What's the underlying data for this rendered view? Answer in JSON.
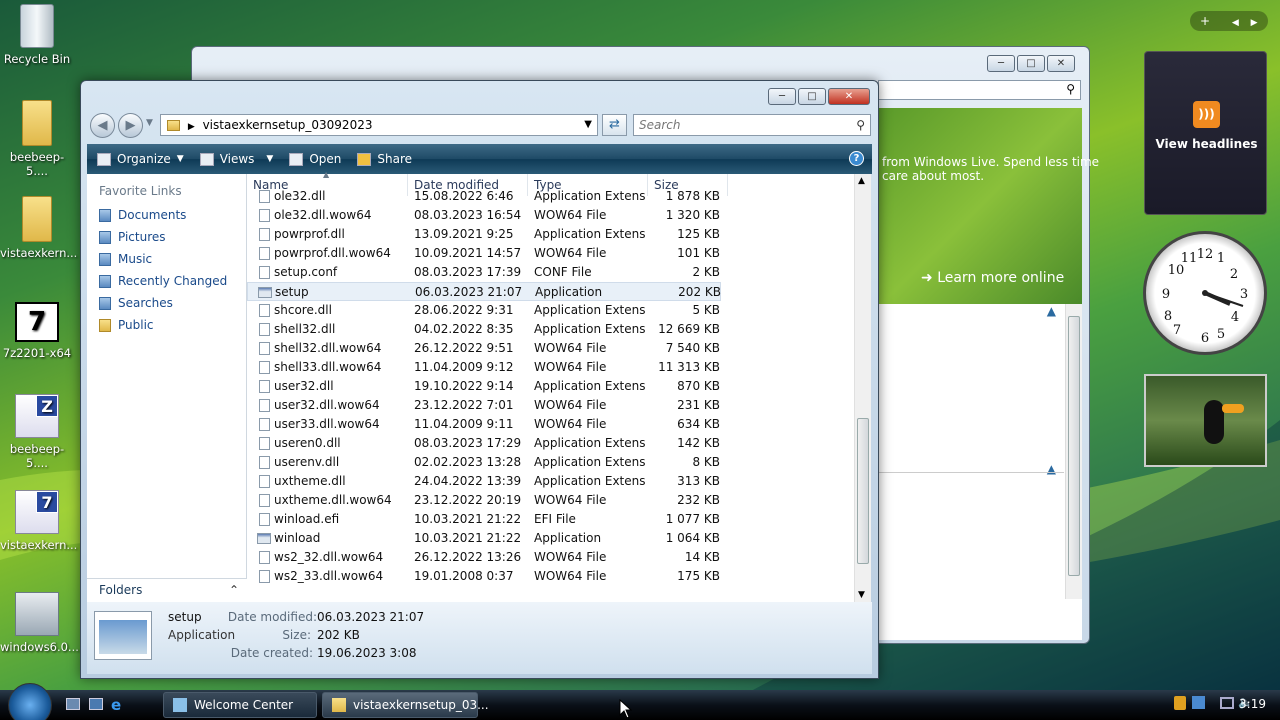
{
  "desktop_icons": [
    {
      "label": "Recycle Bin"
    },
    {
      "label": "beebeep-5...."
    },
    {
      "label": "vistaexkern..."
    },
    {
      "label": "7z2201-x64"
    },
    {
      "label": "beebeep-5...."
    },
    {
      "label": "vistaexkern..."
    },
    {
      "label": "windows6.0...."
    }
  ],
  "icon_glyphs": {
    "zip": "Z",
    "sevenzip": "7"
  },
  "welcome_center": {
    "text": "from Windows Live. Spend less time\ncare about most.",
    "link": "Learn more online"
  },
  "explorer": {
    "address": "vistaexkernsetup_03092023",
    "search_placeholder": "Search",
    "toolbar": {
      "organize": "Organize",
      "views": "Views",
      "open": "Open",
      "share": "Share"
    },
    "nav": {
      "heading": "Favorite Links",
      "links": [
        "Documents",
        "Pictures",
        "Music",
        "Recently Changed",
        "Searches",
        "Public"
      ],
      "folders": "Folders"
    },
    "columns": {
      "name": "Name",
      "date": "Date modified",
      "type": "Type",
      "size": "Size"
    },
    "files": [
      {
        "name": "ole32.dll",
        "date": "15.08.2022 6:46",
        "type": "Application Extens...",
        "size": "1 878 KB"
      },
      {
        "name": "ole32.dll.wow64",
        "date": "08.03.2023 16:54",
        "type": "WOW64 File",
        "size": "1 320 KB"
      },
      {
        "name": "powrprof.dll",
        "date": "13.09.2021 9:25",
        "type": "Application Extens...",
        "size": "125 KB"
      },
      {
        "name": "powrprof.dll.wow64",
        "date": "10.09.2021 14:57",
        "type": "WOW64 File",
        "size": "101 KB"
      },
      {
        "name": "setup.conf",
        "date": "08.03.2023 17:39",
        "type": "CONF File",
        "size": "2 KB"
      },
      {
        "name": "setup",
        "date": "06.03.2023 21:07",
        "type": "Application",
        "size": "202 KB"
      },
      {
        "name": "shcore.dll",
        "date": "28.06.2022 9:31",
        "type": "Application Extens...",
        "size": "5 KB"
      },
      {
        "name": "shell32.dll",
        "date": "04.02.2022 8:35",
        "type": "Application Extens...",
        "size": "12 669 KB"
      },
      {
        "name": "shell32.dll.wow64",
        "date": "26.12.2022 9:51",
        "type": "WOW64 File",
        "size": "7 540 KB"
      },
      {
        "name": "shell33.dll.wow64",
        "date": "11.04.2009 9:12",
        "type": "WOW64 File",
        "size": "11 313 KB"
      },
      {
        "name": "user32.dll",
        "date": "19.10.2022 9:14",
        "type": "Application Extens...",
        "size": "870 KB"
      },
      {
        "name": "user32.dll.wow64",
        "date": "23.12.2022 7:01",
        "type": "WOW64 File",
        "size": "231 KB"
      },
      {
        "name": "user33.dll.wow64",
        "date": "11.04.2009 9:11",
        "type": "WOW64 File",
        "size": "634 KB"
      },
      {
        "name": "useren0.dll",
        "date": "08.03.2023 17:29",
        "type": "Application Extens...",
        "size": "142 KB"
      },
      {
        "name": "userenv.dll",
        "date": "02.02.2023 13:28",
        "type": "Application Extens...",
        "size": "8 KB"
      },
      {
        "name": "uxtheme.dll",
        "date": "24.04.2022 13:39",
        "type": "Application Extens...",
        "size": "313 KB"
      },
      {
        "name": "uxtheme.dll.wow64",
        "date": "23.12.2022 20:19",
        "type": "WOW64 File",
        "size": "232 KB"
      },
      {
        "name": "winload.efi",
        "date": "10.03.2021 21:22",
        "type": "EFI File",
        "size": "1 077 KB"
      },
      {
        "name": "winload",
        "date": "10.03.2021 21:22",
        "type": "Application",
        "size": "1 064 KB"
      },
      {
        "name": "ws2_32.dll.wow64",
        "date": "26.12.2022 13:26",
        "type": "WOW64 File",
        "size": "14 KB"
      },
      {
        "name": "ws2_33.dll.wow64",
        "date": "19.01.2008 0:37",
        "type": "WOW64 File",
        "size": "175 KB"
      }
    ],
    "details": {
      "name": "setup",
      "type": "Application",
      "modified_label": "Date modified:",
      "modified": "06.03.2023 21:07",
      "size_label": "Size:",
      "size": "202 KB",
      "created_label": "Date created:",
      "created": "19.06.2023 3:08"
    }
  },
  "gadgets": {
    "rss": "View headlines"
  },
  "taskbar": {
    "items": [
      "Welcome Center",
      "vistaexkernsetup_03..."
    ],
    "time": "3:19"
  }
}
